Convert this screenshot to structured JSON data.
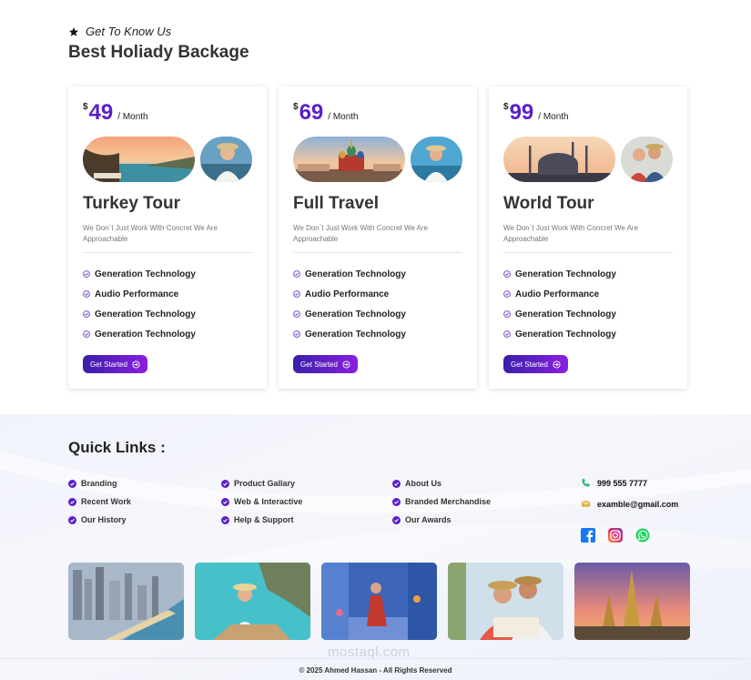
{
  "header": {
    "eyebrow": "Get To Know Us",
    "title": "Best Holiady Backage"
  },
  "cards": [
    {
      "currency": "$",
      "price": "49",
      "period": "/ Month",
      "title": "Turkey Tour",
      "description": "We Don`t Just Work With Concret We Are Approachable",
      "features": [
        "Generation Technology",
        "Audio Performance",
        "Generation Technology",
        "Generation Technology"
      ],
      "button": "Get Started"
    },
    {
      "currency": "$",
      "price": "69",
      "period": "/ Month",
      "title": "Full Travel",
      "description": "We Don`t Just Work With Concret We Are Approachable",
      "features": [
        "Generation Technology",
        "Audio Performance",
        "Generation Technology",
        "Generation Technology"
      ],
      "button": "Get Started"
    },
    {
      "currency": "$",
      "price": "99",
      "period": "/ Month",
      "title": "World Tour",
      "description": "We Don`t Just Work With Concret We Are Approachable",
      "features": [
        "Generation Technology",
        "Audio Performance",
        "Generation Technology",
        "Generation Technology"
      ],
      "button": "Get Started"
    }
  ],
  "footer": {
    "quick_links_title": "Quick Links :",
    "columns": [
      [
        "Branding",
        "Recent Work",
        "Our History"
      ],
      [
        "Product Gallary",
        "Web & Interactive",
        "Help & Support"
      ],
      [
        "About Us",
        "Branded Merchandise",
        "Our Awards"
      ]
    ],
    "phone": "999 555 7777",
    "email": "examble@gmail.com",
    "socials": [
      "facebook-icon",
      "instagram-icon",
      "whatsapp-icon"
    ],
    "copyright": "© 2025 Ahmed Hassan - All Rights Reserved",
    "watermark": "mostaql.com"
  },
  "colors": {
    "accent": "#5b1fc9",
    "button_start": "#3a1fa8",
    "button_end": "#8b1fe0",
    "phone_icon": "#2bb673",
    "email_icon": "#e0b23a"
  }
}
